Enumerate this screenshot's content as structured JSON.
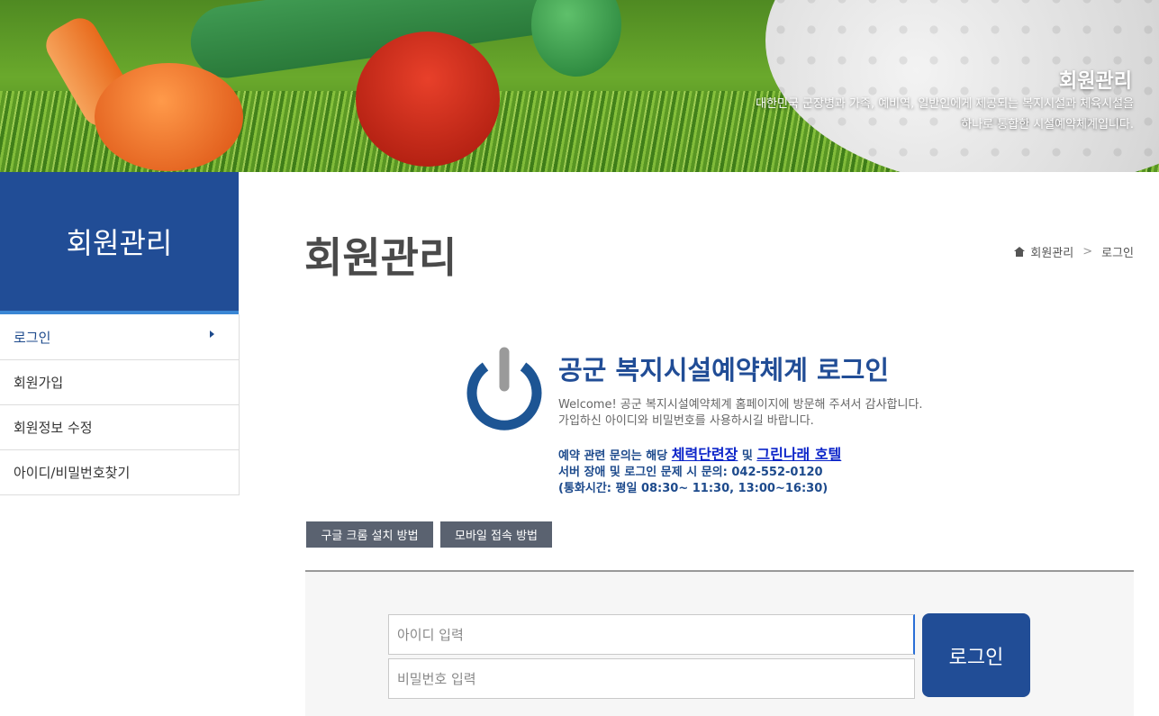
{
  "banner": {
    "title": "회원관리",
    "desc_line1": "대한민국 군장병과 가족, 예비역, 일반인에게 제공되는 복지시설과 체육시설을",
    "desc_line2": "하나로 통합한 시설예약체계입니다."
  },
  "sidebar": {
    "title": "회원관리",
    "items": [
      {
        "label": "로그인"
      },
      {
        "label": "회원가입"
      },
      {
        "label": "회원정보 수정"
      },
      {
        "label": "아이디/비밀번호찾기"
      }
    ]
  },
  "main": {
    "title": "회원관리",
    "breadcrumb": [
      "회원관리",
      "로그인"
    ],
    "login_title": "공군 복지시설예약체계 로그인",
    "welcome_line1": "Welcome! 공군 복지시설예약체계 홈페이지에 방문해 주셔서 감사합니다.",
    "welcome_line2": "가입하신 아이디와 비밀번호를 사용하시길 바랍니다.",
    "inquiry_prefix": "예약 관련 문의는 해당 ",
    "inquiry_link1": "체력단련장",
    "inquiry_mid": " 및 ",
    "inquiry_link2": "그린나래 호텔",
    "inquiry_line2": "서버 장애 및 로그인 문제 시 문의: 042-552-0120",
    "inquiry_line3": "(통화시간: 평일 08:30~ 11:30, 13:00~16:30)",
    "btn_chrome": "구글 크롬 설치 방법",
    "btn_mobile": "모바일 접속 방법"
  },
  "login_form": {
    "id_placeholder": "아이디 입력",
    "pw_placeholder": "비밀번호 입력",
    "submit_label": "로그인"
  },
  "colors": {
    "primary": "#214d96",
    "accent_blue": "#3a86d4",
    "link": "#0b24c9",
    "grey_button": "#5a6270"
  }
}
